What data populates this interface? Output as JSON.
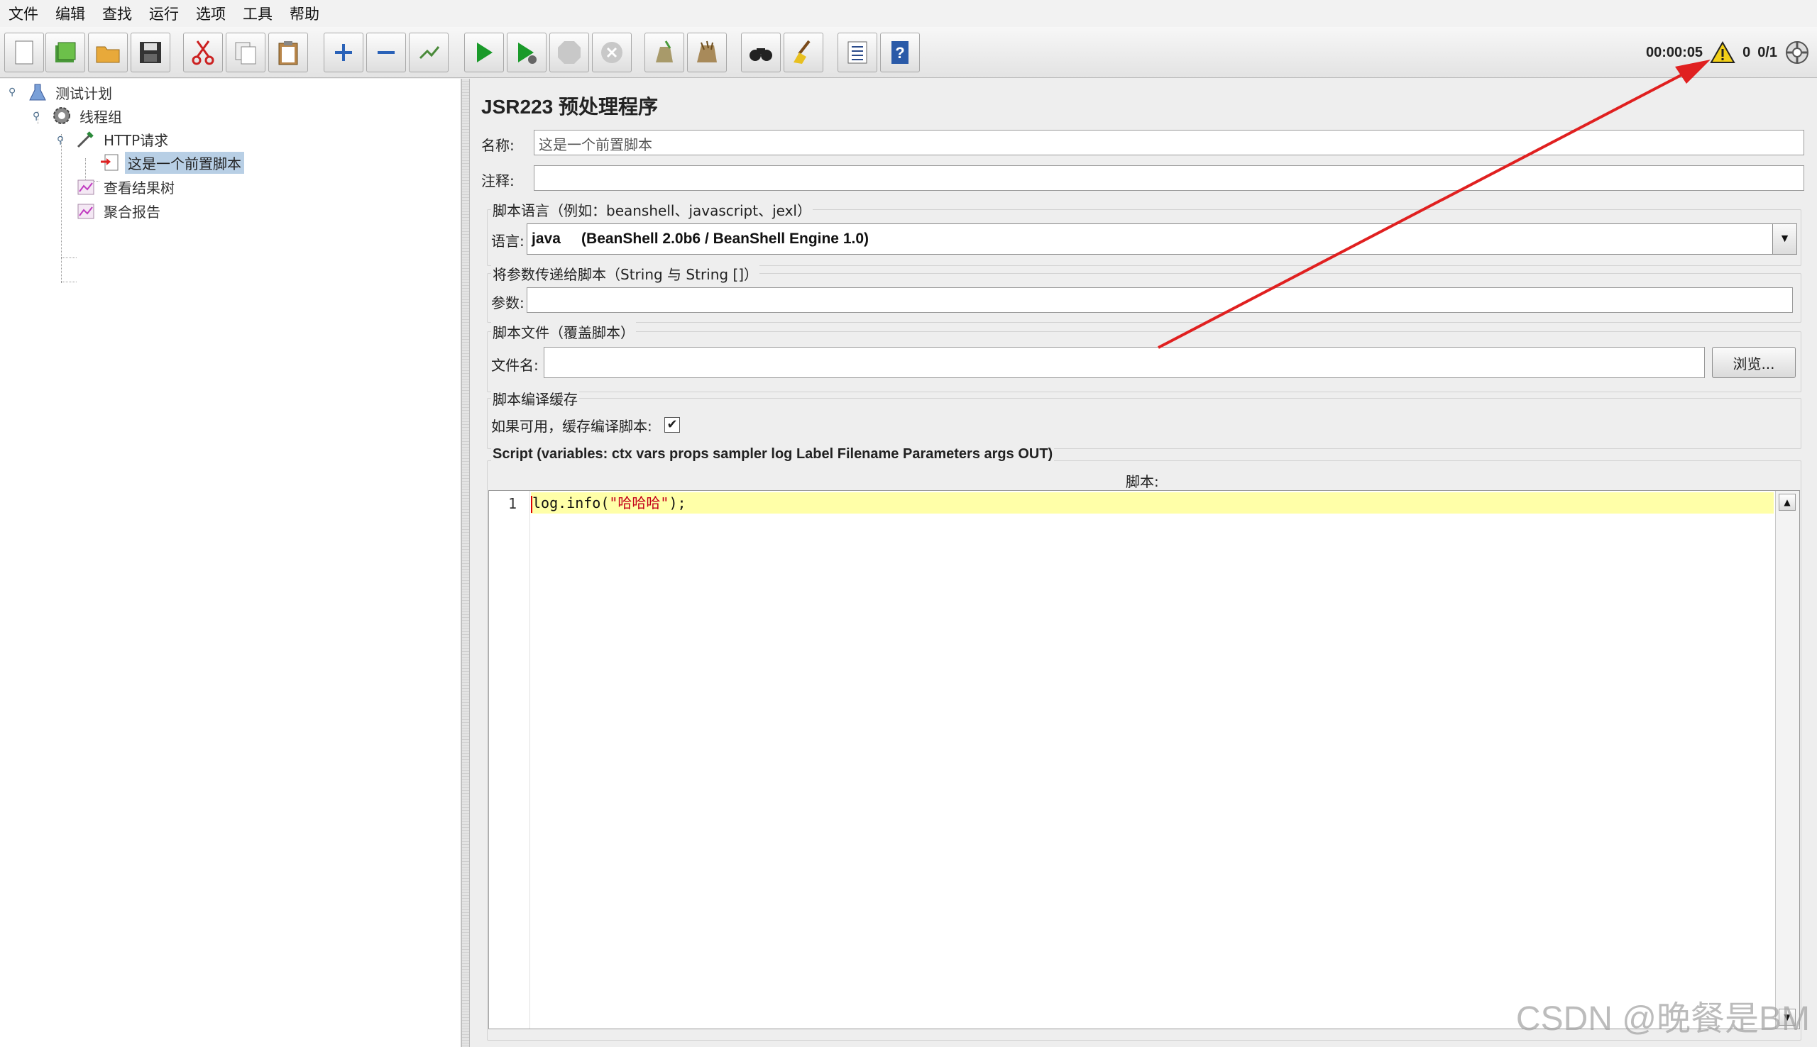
{
  "menubar": {
    "items": [
      "文件",
      "编辑",
      "查找",
      "运行",
      "选项",
      "工具",
      "帮助"
    ]
  },
  "toolbar": {
    "buttons": [
      "new-icon",
      "templates-icon",
      "open-icon",
      "save-icon",
      "cut-icon",
      "copy-icon",
      "paste-icon",
      "expand-icon",
      "collapse-icon",
      "toggle-icon",
      "start-icon",
      "start-no-pause-icon",
      "stop-icon",
      "shutdown-icon",
      "clear-icon",
      "clear-all-icon",
      "search-icon",
      "reset-search-icon",
      "function-helper-icon",
      "help-icon"
    ],
    "timer": "00:00:05",
    "warning_count": "0",
    "threads": "0/1"
  },
  "tree": {
    "nodes": [
      {
        "label": "测试计划"
      },
      {
        "label": "线程组"
      },
      {
        "label": "HTTP请求"
      },
      {
        "label": "这是一个前置脚本"
      },
      {
        "label": "查看结果树"
      },
      {
        "label": "聚合报告"
      }
    ]
  },
  "form": {
    "title": "JSR223 预处理程序",
    "name_label": "名称:",
    "name_value": "这是一个前置脚本",
    "comment_label": "注释:",
    "comment_value": "",
    "lang_group_title": "脚本语言（例如：beanshell、javascript、jexl）",
    "lang_label": "语言:",
    "lang_value": "java     (BeanShell 2.0b6 / BeanShell Engine 1.0)",
    "params_group_title": "将参数传递给脚本（String 与 String []）",
    "params_label": "参数:",
    "params_value": "",
    "file_group_title": "脚本文件（覆盖脚本）",
    "file_label": "文件名:",
    "file_value": "",
    "browse_label": "浏览...",
    "cache_group_title": "脚本编译缓存",
    "cache_label": "如果可用，缓存编译脚本:",
    "cache_checked": "✔",
    "script_group_title": "Script (variables: ctx vars props sampler log Label Filename Parameters args OUT)",
    "script_label": "脚本:",
    "line_number": "1",
    "code_prefix": "log.info(",
    "code_string": "\"哈哈哈\"",
    "code_suffix": ");"
  },
  "watermark": "CSDN @晚餐是BM",
  "colors": {
    "accent_arrow": "#e02020",
    "selection": "#b8cfe5",
    "current_line": "#ffffa8",
    "string_literal": "#c4001a"
  }
}
